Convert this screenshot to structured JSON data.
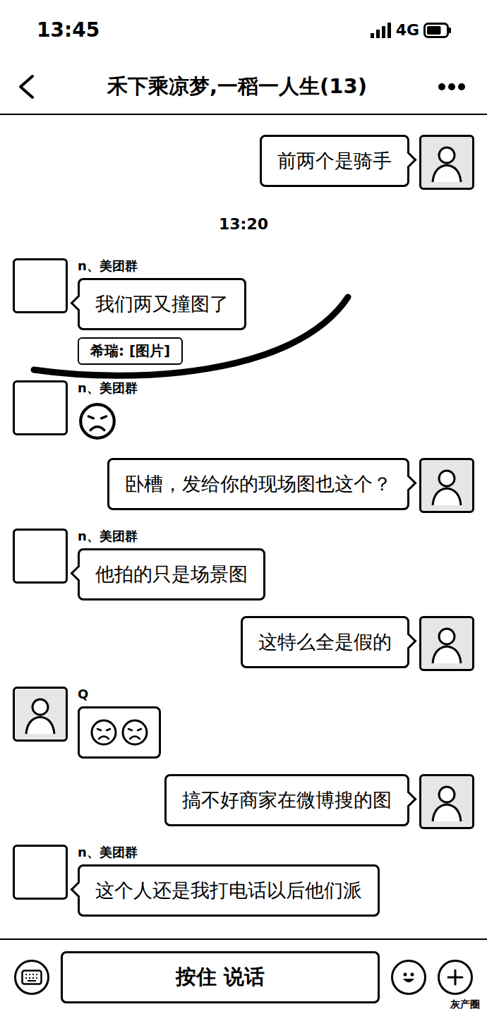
{
  "status_bar": {
    "time": "13:45",
    "network": "4G",
    "battery_level": 0.75
  },
  "header": {
    "title": "禾下乘凉梦,一稻一人生(13)"
  },
  "messages": [
    {
      "kind": "text",
      "side": "self",
      "text": "前两个是骑手",
      "avatar": "photo"
    },
    {
      "kind": "time",
      "text": "13:20"
    },
    {
      "kind": "text",
      "side": "other",
      "sender": "n、美团群",
      "text": "我们两又撞图了",
      "quote": "希瑞: [图片]",
      "avatar": "blank",
      "annotated": true
    },
    {
      "kind": "sticker",
      "side": "other",
      "sender": "n、美团群",
      "faces": 1,
      "in_bubble": false,
      "avatar": "blank"
    },
    {
      "kind": "text",
      "side": "self",
      "text": "卧槽，发给你的现场图也这个？",
      "avatar": "photo"
    },
    {
      "kind": "text",
      "side": "other",
      "sender": "n、美团群",
      "text": "他拍的只是场景图",
      "avatar": "blank",
      "annotated": false
    },
    {
      "kind": "text",
      "side": "self",
      "text": "这特么全是假的",
      "avatar": "photo"
    },
    {
      "kind": "sticker",
      "side": "other",
      "sender": "Q",
      "faces": 2,
      "in_bubble": true,
      "avatar": "drawing"
    },
    {
      "kind": "text",
      "side": "self",
      "text": "搞不好商家在微博搜的图",
      "avatar": "photo"
    },
    {
      "kind": "text",
      "side": "other",
      "sender": "n、美团群",
      "text": "这个人还是我打电话以后他们派",
      "avatar": "blank",
      "annotated": false
    }
  ],
  "input_bar": {
    "voice_button": "按住 说话"
  },
  "watermark": "灰产圈"
}
